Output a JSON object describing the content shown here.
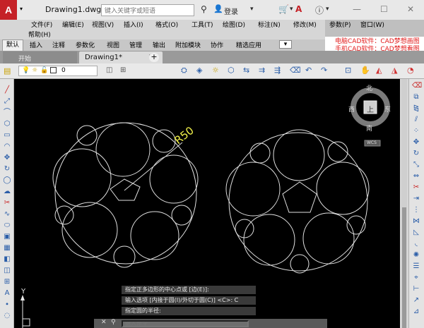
{
  "app": {
    "logo_letter": "A"
  },
  "title": {
    "document": "Drawing1.dwg",
    "search_placeholder": "键入关键字或短语",
    "login": "登录"
  },
  "menu": {
    "items": [
      "文件(F)",
      "编辑(E)",
      "视图(V)",
      "插入(I)",
      "格式(O)",
      "工具(T)",
      "绘图(D)",
      "标注(N)",
      "修改(M)",
      "参数(P)",
      "窗口(W)",
      "帮助(H)"
    ]
  },
  "ribbon": {
    "tabs": [
      "默认",
      "插入",
      "注释",
      "参数化",
      "视图",
      "管理",
      "输出",
      "附加模块",
      "协作",
      "精选应用"
    ]
  },
  "promo": {
    "line1": "电脑CAD软件：CAD梦想画图",
    "line2": "手机CAD软件：CAD梦想看图"
  },
  "doc_tabs": {
    "start": "开始",
    "active": "Drawing1*",
    "add": "+"
  },
  "layer": {
    "current": "0"
  },
  "drawing": {
    "label": "R50"
  },
  "viewcube": {
    "north": "北",
    "south": "南",
    "west": "西",
    "east": "东",
    "top": "上",
    "ucs": "WCS"
  },
  "command": {
    "lines": [
      "指定正多边形的中心点或 [边(E)]:",
      "输入选项 [内接于圆(I)/外切于圆(C)] <C>: C",
      "指定圆的半径:"
    ],
    "input_placeholder": "键入命令"
  },
  "ucs_icon": {
    "y_label": "Y"
  }
}
